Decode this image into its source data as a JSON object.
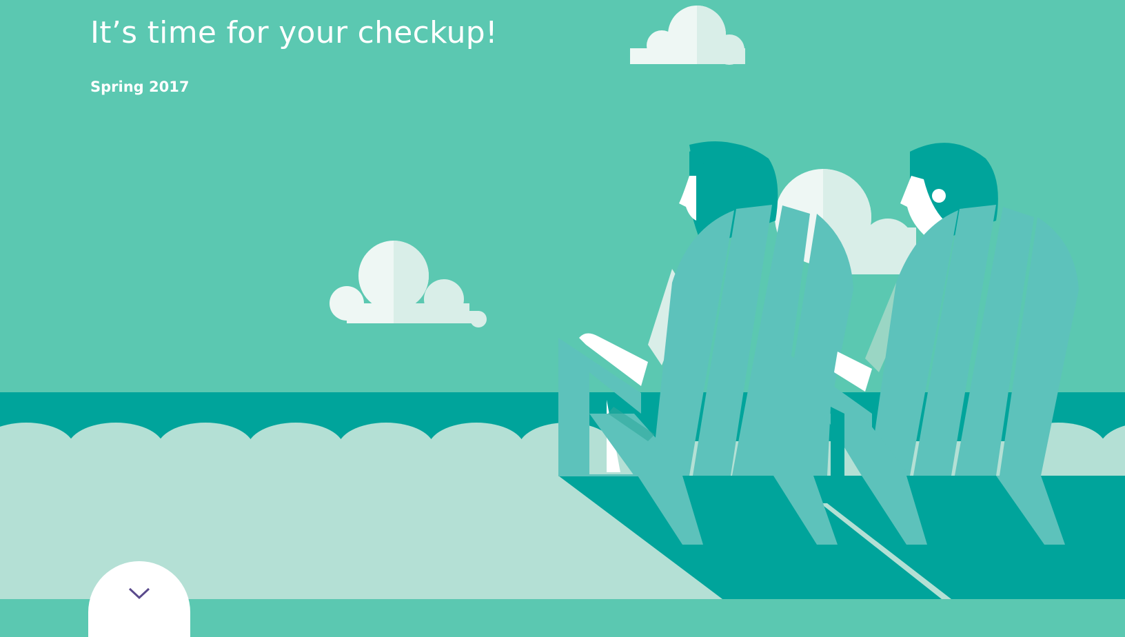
{
  "hero": {
    "title": "It’s time for your checkup!",
    "subtitle": "Spring 2017"
  },
  "scroll_button": {
    "icon": "chevron-down-icon"
  },
  "colors": {
    "sky": "#5bc8b1",
    "sea": "#00a49b",
    "ground": "#b4e0d5",
    "chair": "#5dc2bb",
    "hair": "#00a49b",
    "cloud_light": "#eef7f4",
    "cloud_shade": "#d9eee8",
    "chevron": "#5a4a8c"
  }
}
